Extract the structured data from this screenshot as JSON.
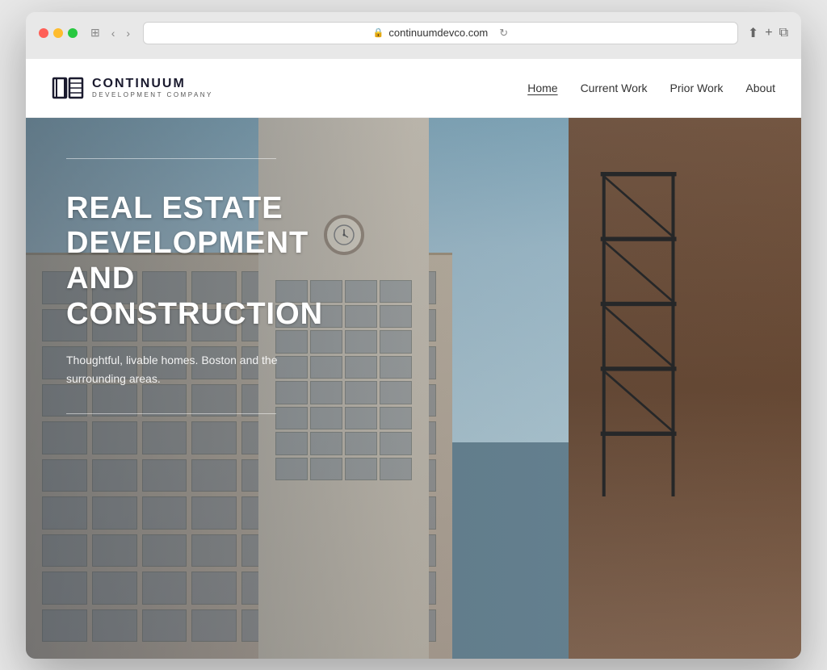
{
  "browser": {
    "url": "continuumdevco.com",
    "tab_icon": "🔒",
    "back_label": "‹",
    "forward_label": "›",
    "reload_label": "↻",
    "share_label": "⬆",
    "new_tab_label": "+",
    "windows_label": "⧉"
  },
  "nav": {
    "logo_name": "CONTINUUM",
    "logo_sub": "DEVELOPMENT COMPANY",
    "links": [
      {
        "label": "Home",
        "active": true
      },
      {
        "label": "Current Work",
        "active": false
      },
      {
        "label": "Prior Work",
        "active": false
      },
      {
        "label": "About",
        "active": false
      }
    ]
  },
  "hero": {
    "title": "REAL ESTATE\nDEVELOPMENT\nAND CONSTRUCTION",
    "subtitle": "Thoughtful, livable homes. Boston and the surrounding areas."
  }
}
